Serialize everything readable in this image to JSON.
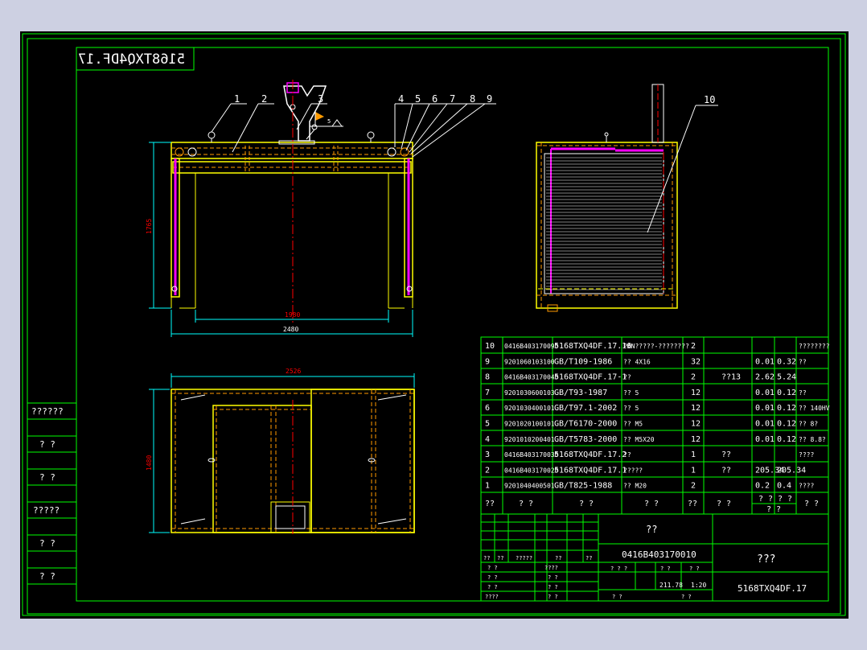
{
  "colors": {
    "background": "#cdd0e2",
    "sheet": "#000000",
    "frame": "#00ff00",
    "outline": "#ffff00",
    "hidden": "#ff9a00",
    "center": "#ff0000",
    "dimension": "#00ffff",
    "highlight": "#ff00ff",
    "text": "#ffffff"
  },
  "drawing_number_mirrored": "5168TXQ4DF.17",
  "left_column_labels": [
    "??????",
    "? ?",
    "? ?",
    "?????",
    "? ?",
    "? ?"
  ],
  "front_view": {
    "callouts": [
      "1",
      "2",
      "3",
      "4",
      "5",
      "6",
      "7",
      "8",
      "9"
    ],
    "weld_note": "5",
    "dims": {
      "height": "1765",
      "inner_width": "1980",
      "outer_width": "2480"
    }
  },
  "side_view": {
    "callout": "10"
  },
  "bottom_view": {
    "dims": {
      "width": "2526",
      "height": "1480"
    }
  },
  "bom": {
    "rows": [
      {
        "no": "10",
        "code": "0416B403170090",
        "std": "5168TXQ4DF.17.10",
        "name": "PAN?????-????????",
        "qty": "2",
        "mat": "",
        "w1": "",
        "w2": "",
        "note": "????????"
      },
      {
        "no": "9",
        "code": "9201060103100",
        "std": "GB/T109-1986",
        "name": "?? 4X16",
        "qty": "32",
        "mat": "",
        "w1": "0.01",
        "w2": "0.32",
        "note": "??"
      },
      {
        "no": "8",
        "code": "0416B403170040",
        "std": "5168TXQ4DF.17-1",
        "name": "??",
        "qty": "2",
        "mat": "??13",
        "w1": "2.62",
        "w2": "5.24",
        "note": ""
      },
      {
        "no": "7",
        "code": "9201030600103",
        "std": "GB/T93-1987",
        "name": "?? 5",
        "qty": "12",
        "mat": "",
        "w1": "0.01",
        "w2": "0.12",
        "note": "??"
      },
      {
        "no": "6",
        "code": "9201030400101",
        "std": "GB/T97.1-2002",
        "name": "?? 5",
        "qty": "12",
        "mat": "",
        "w1": "0.01",
        "w2": "0.12",
        "note": "?? 140HV"
      },
      {
        "no": "5",
        "code": "9201020100101",
        "std": "GB/T6170-2000",
        "name": "?? M5",
        "qty": "12",
        "mat": "",
        "w1": "0.01",
        "w2": "0.12",
        "note": "?? 8?"
      },
      {
        "no": "4",
        "code": "9201010200401",
        "std": "GB/T5783-2000",
        "name": "?? M5X20",
        "qty": "12",
        "mat": "",
        "w1": "0.01",
        "w2": "0.12",
        "note": "?? 8.8?"
      },
      {
        "no": "3",
        "code": "0416B403170030",
        "std": "5168TXQ4DF.17.2",
        "name": "??",
        "qty": "1",
        "mat": "??",
        "w1": "",
        "w2": "",
        "note": "????"
      },
      {
        "no": "2",
        "code": "0416B403170020",
        "std": "5168TXQ4DF.17.1",
        "name": "?????",
        "qty": "1",
        "mat": "??",
        "w1": "205.34",
        "w2": "205.34",
        "note": ""
      },
      {
        "no": "1",
        "code": "9201040400501",
        "std": "GB/T825-1988",
        "name": "?? M20",
        "qty": "2",
        "mat": "",
        "w1": "0.2",
        "w2": "0.4",
        "note": "????"
      }
    ],
    "header": {
      "no": "??",
      "code": "? ?",
      "std": "? ?",
      "name": "? ?",
      "qty": "??",
      "mat": "? ?",
      "w1": "? ?",
      "w2": "? ?",
      "note": "? ?"
    },
    "header_sub": "? ?"
  },
  "title_block": {
    "top_title": "??",
    "part_code": "0416B403170010",
    "drawing_title": "???",
    "drawing_number": "5168TXQ4DF.17",
    "weight": "211.78",
    "scale": "1:20",
    "sign_labels": [
      "??",
      "??",
      "?????",
      "??",
      "??"
    ],
    "left_rows": [
      "? ?",
      "? ?",
      "? ?",
      "????"
    ],
    "left_rows2": [
      "????",
      "? ?",
      "? ?",
      "? ?"
    ],
    "stage_labels": [
      "? ? ?",
      "? ?",
      "? ?"
    ],
    "sheet_labels": [
      "? ?",
      "? ?"
    ]
  }
}
